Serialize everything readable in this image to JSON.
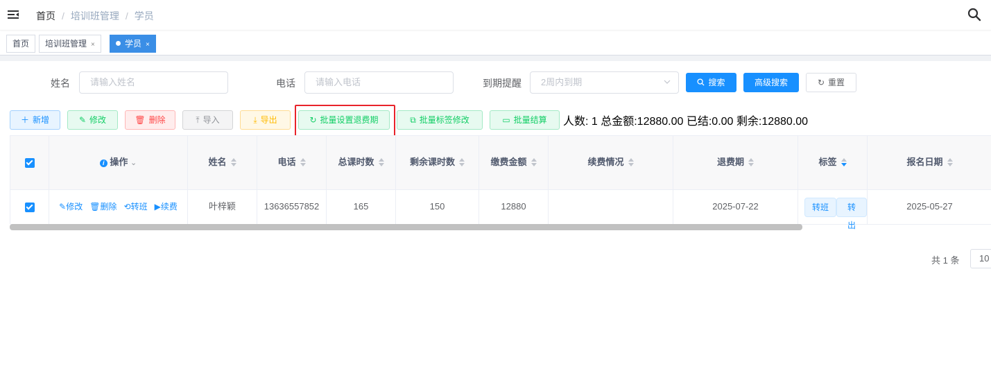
{
  "breadcrumb": [
    "首页",
    "培训班管理",
    "学员"
  ],
  "tags": [
    {
      "label": "首页",
      "close": ""
    },
    {
      "label": "培训班管理",
      "close": "×"
    },
    {
      "label": "学员",
      "close": "×"
    }
  ],
  "search_form": {
    "name_label": "姓名",
    "name_placeholder": "请输入姓名",
    "phone_label": "电话",
    "phone_placeholder": "请输入电话",
    "expiry_label": "到期提醒",
    "expiry_placeholder": "2周内到期",
    "search_button": "搜索",
    "advanced_button": "高级搜索",
    "reset_button": "重置"
  },
  "toolbar": {
    "add": "新增",
    "edit": "修改",
    "delete": "删除",
    "import": "导入",
    "export": "导出",
    "batch_refund": "批量设置退费期",
    "batch_tag": "批量标签修改",
    "batch_settle": "批量结算"
  },
  "summary": "人数: 1 总金额:12880.00 已结:0.00 剩余:12880.00",
  "table": {
    "headers": [
      "操作",
      "姓名",
      "电话",
      "总课时数",
      "剩余课时数",
      "缴费金额",
      "续费情况",
      "退费期",
      "标签",
      "报名日期"
    ],
    "rows": [
      {
        "actions": [
          "修改",
          "删除",
          "转班",
          "续费"
        ],
        "name": "叶梓颖",
        "phone": "13636557852",
        "total_hours": "165",
        "remaining_hours": "150",
        "amount": "12880",
        "renewal": "",
        "refund_date": "2025-07-22",
        "tags": [
          "转班",
          "转出"
        ],
        "signup_date": "2025-05-27"
      }
    ]
  },
  "pagination": {
    "total": "共 1 条",
    "page_size": "10"
  },
  "colors": {
    "primary": "#1890ff",
    "highlight": "#e8232a"
  }
}
